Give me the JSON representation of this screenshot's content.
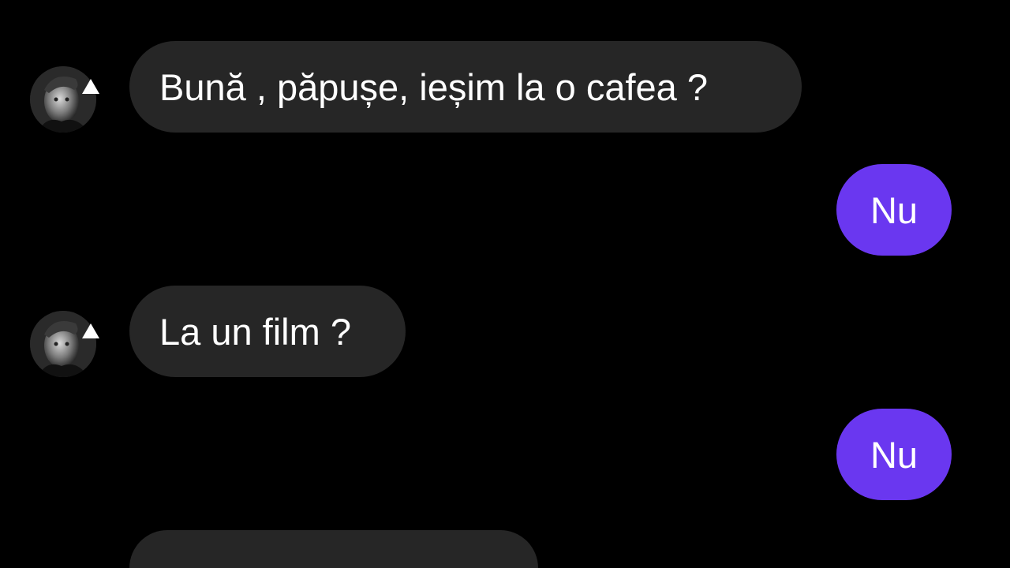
{
  "conversation": {
    "messages": [
      {
        "sender": "other",
        "text": "Bună , păpușe, ieșim la o cafea ?"
      },
      {
        "sender": "me",
        "text": "Nu"
      },
      {
        "sender": "other",
        "text": "La un film ?"
      },
      {
        "sender": "me",
        "text": "Nu"
      },
      {
        "sender": "other",
        "text": ""
      }
    ]
  },
  "colors": {
    "background": "#000000",
    "incoming_bubble": "#262626",
    "outgoing_bubble": "#6a37f0",
    "text": "#ffffff"
  },
  "icons": {
    "contact_avatar": "contact-avatar-photo"
  }
}
